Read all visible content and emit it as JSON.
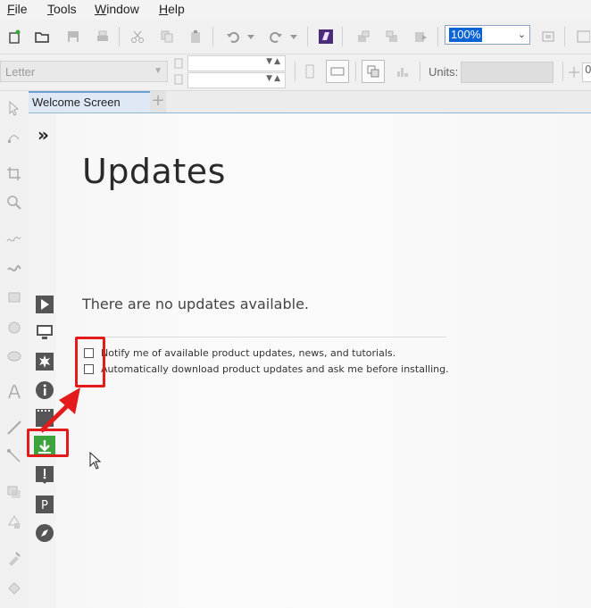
{
  "menu": {
    "file_prefix": "",
    "file_u": "F",
    "file_rest": "ile",
    "tools_u": "T",
    "tools_rest": "ools",
    "window_u": "W",
    "window_rest": "indow",
    "help_u": "H",
    "help_rest": "elp"
  },
  "toolbar": {
    "zoom_value": "100%"
  },
  "property_bar": {
    "paper_size": "Letter",
    "units_label": "Units:",
    "readout_fragment": "0"
  },
  "tabs": {
    "active_label": "Welcome Screen",
    "add_label": "+"
  },
  "welcome": {
    "expand_glyph": "»",
    "title": "Updates",
    "status": "There are no updates available.",
    "options": [
      {
        "label": "Notify me of available product updates, news, and tutorials.",
        "checked": false
      },
      {
        "label": "Automatically download product updates and ask me before installing.",
        "checked": false
      }
    ]
  },
  "colors": {
    "accent_highlight": "#e31b1b",
    "active_nav": "#3da43d",
    "zoom_selection": "#0a64d6"
  }
}
